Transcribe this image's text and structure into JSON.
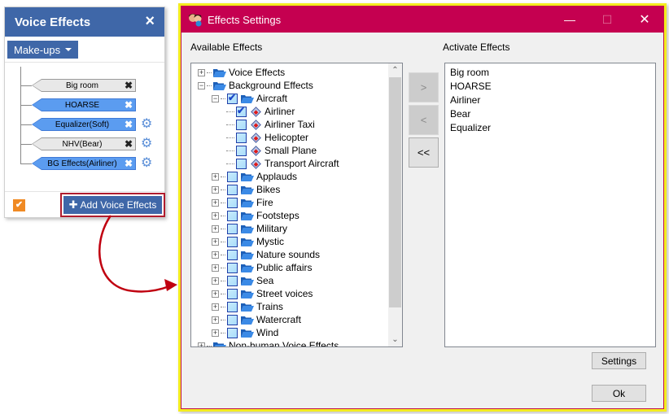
{
  "voice_panel": {
    "title": "Voice Effects",
    "close_icon": "×",
    "dropdown_label": "Make-ups",
    "chips": [
      {
        "label": "Big room",
        "style": "grey",
        "has_settings": false
      },
      {
        "label": "HOARSE",
        "style": "blue",
        "has_settings": false
      },
      {
        "label": "Equalizer(Soft)",
        "style": "blue",
        "has_settings": true
      },
      {
        "label": "NHV(Bear)",
        "style": "grey",
        "has_settings": true
      },
      {
        "label": "BG Effects(Airliner)",
        "style": "blue",
        "has_settings": true
      }
    ],
    "remove_glyph": "✖",
    "gear_glyph": "⚙",
    "enabled_check": "✔",
    "add_button_icon": "✚",
    "add_button_label": "Add Voice Effects"
  },
  "dialog": {
    "title": "Effects Settings",
    "minimize_glyph": "—",
    "maximize_glyph": "☐",
    "close_glyph": "✕",
    "available_label": "Available Effects",
    "active_label": "Activate Effects",
    "tree": [
      {
        "label": "Voice Effects",
        "level": 0,
        "expander": "+",
        "checkbox": false,
        "icon": "folder"
      },
      {
        "label": "Background Effects",
        "level": 0,
        "expander": "−",
        "checkbox": false,
        "icon": "folder"
      },
      {
        "label": "Aircraft",
        "level": 1,
        "expander": "−",
        "checkbox": true,
        "checked": true,
        "icon": "folder"
      },
      {
        "label": "Airliner",
        "level": 2,
        "expander": "",
        "checkbox": true,
        "checked": true,
        "icon": "diamond"
      },
      {
        "label": "Airliner Taxi",
        "level": 2,
        "expander": "",
        "checkbox": true,
        "checked": false,
        "icon": "diamond"
      },
      {
        "label": "Helicopter",
        "level": 2,
        "expander": "",
        "checkbox": true,
        "checked": false,
        "icon": "diamond"
      },
      {
        "label": "Small Plane",
        "level": 2,
        "expander": "",
        "checkbox": true,
        "checked": false,
        "icon": "diamond"
      },
      {
        "label": "Transport Aircraft",
        "level": 2,
        "expander": "",
        "checkbox": true,
        "checked": false,
        "icon": "diamond"
      },
      {
        "label": "Applauds",
        "level": 1,
        "expander": "+",
        "checkbox": true,
        "checked": false,
        "icon": "folder"
      },
      {
        "label": "Bikes",
        "level": 1,
        "expander": "+",
        "checkbox": true,
        "checked": false,
        "icon": "folder"
      },
      {
        "label": "Fire",
        "level": 1,
        "expander": "+",
        "checkbox": true,
        "checked": false,
        "icon": "folder"
      },
      {
        "label": "Footsteps",
        "level": 1,
        "expander": "+",
        "checkbox": true,
        "checked": false,
        "icon": "folder"
      },
      {
        "label": "Military",
        "level": 1,
        "expander": "+",
        "checkbox": true,
        "checked": false,
        "icon": "folder"
      },
      {
        "label": "Mystic",
        "level": 1,
        "expander": "+",
        "checkbox": true,
        "checked": false,
        "icon": "folder"
      },
      {
        "label": "Nature sounds",
        "level": 1,
        "expander": "+",
        "checkbox": true,
        "checked": false,
        "icon": "folder"
      },
      {
        "label": "Public affairs",
        "level": 1,
        "expander": "+",
        "checkbox": true,
        "checked": false,
        "icon": "folder"
      },
      {
        "label": "Sea",
        "level": 1,
        "expander": "+",
        "checkbox": true,
        "checked": false,
        "icon": "folder"
      },
      {
        "label": "Street voices",
        "level": 1,
        "expander": "+",
        "checkbox": true,
        "checked": false,
        "icon": "folder"
      },
      {
        "label": "Trains",
        "level": 1,
        "expander": "+",
        "checkbox": true,
        "checked": false,
        "icon": "folder"
      },
      {
        "label": "Watercraft",
        "level": 1,
        "expander": "+",
        "checkbox": true,
        "checked": false,
        "icon": "folder"
      },
      {
        "label": "Wind",
        "level": 1,
        "expander": "+",
        "checkbox": true,
        "checked": false,
        "icon": "folder"
      },
      {
        "label": "Non-human Voice Effects",
        "level": 0,
        "expander": "+",
        "checkbox": false,
        "icon": "folder"
      }
    ],
    "scroll_up_glyph": "⌃",
    "scroll_down_glyph": "⌄",
    "add_button": ">",
    "remove_button": "<",
    "remove_all_button": "<<",
    "active_effects": [
      "Big room",
      "HOARSE",
      "Airliner",
      "Bear",
      "Equalizer"
    ],
    "settings_button": "Settings",
    "ok_button": "Ok"
  },
  "colors": {
    "panel_blue": "#3f67a8",
    "chip_blue": "#5b9cf0",
    "title_bar": "#c50050",
    "highlight_yellow": "#f4ec1e",
    "arrow_red": "#c00010",
    "check_orange": "#f08a24"
  }
}
